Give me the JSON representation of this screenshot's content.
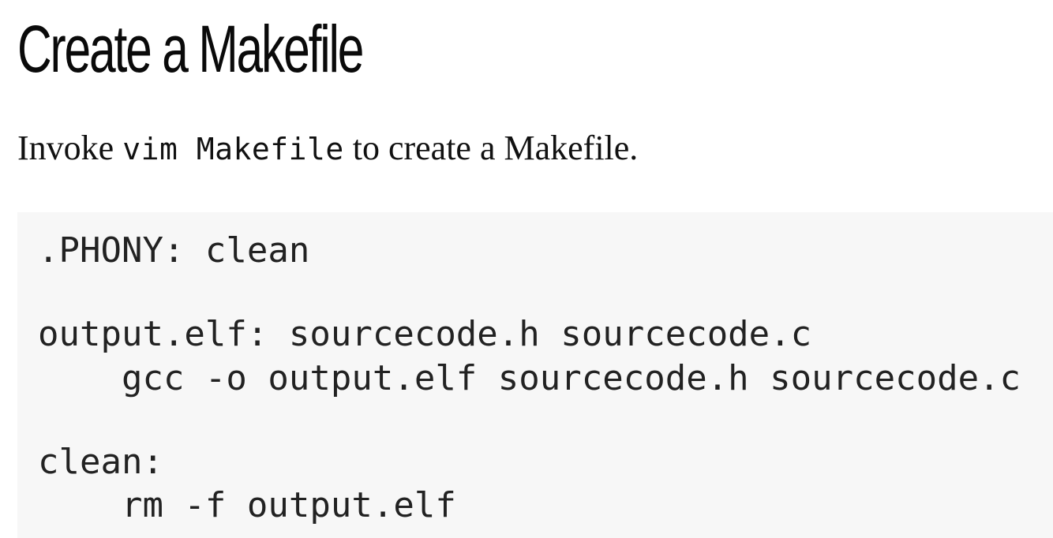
{
  "heading": "Create a Makefile",
  "intro": {
    "before": "Invoke ",
    "code": "vim Makefile",
    "after": " to create a Makefile."
  },
  "code_lines": [
    ".PHONY: clean",
    "output.elf: sourcecode.h sourcecode.c",
    "    gcc -o output.elf sourcecode.h sourcecode.c",
    "clean:",
    "    rm -f output.elf"
  ]
}
